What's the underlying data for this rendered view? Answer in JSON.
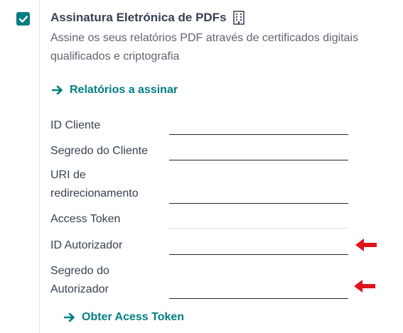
{
  "setting": {
    "checked": true,
    "title": "Assinatura Eletrónica de PDFs",
    "title_icon": "building-icon",
    "description": "Assine os seus relatórios PDF através de certificados digitais qualificados e criptografia"
  },
  "links": {
    "reports": "Relatórios a assinar",
    "get_token": "Obter Acess Token"
  },
  "fields": [
    {
      "label": "ID Cliente",
      "value": ""
    },
    {
      "label": "Segredo do Cliente",
      "value": ""
    },
    {
      "label_line1": "URI de",
      "label_line2": "redirecionamento",
      "value": ""
    },
    {
      "label": "Access Token",
      "value": ""
    },
    {
      "label": "ID Autorizador",
      "value": ""
    },
    {
      "label_line1": "Segredo do",
      "label_line2": "Autorizador",
      "value": ""
    }
  ],
  "colors": {
    "accent": "#017e84",
    "annotation_arrow": "#e0121b"
  }
}
